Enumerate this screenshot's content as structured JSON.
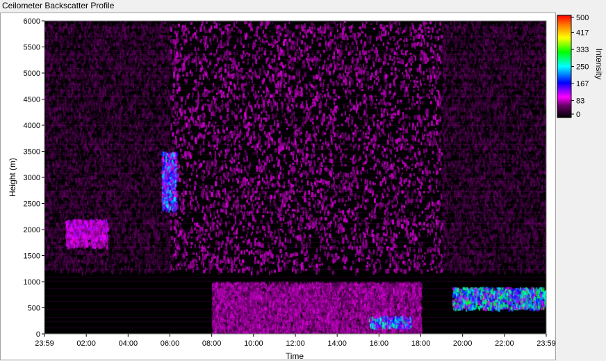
{
  "window": {
    "title": "Ceilometer Backscatter Profile"
  },
  "chart_data": {
    "type": "heatmap",
    "title": "Ceilometer Backscatter Profile",
    "xlabel": "Time",
    "ylabel": "Height (m)",
    "x_ticks": [
      "23:59",
      "02:00",
      "04:00",
      "06:00",
      "08:00",
      "10:00",
      "12:00",
      "14:00",
      "16:00",
      "18:00",
      "20:00",
      "22:00",
      "23:59"
    ],
    "x_range_hours": [
      0,
      24
    ],
    "y_ticks": [
      0,
      500,
      1000,
      1500,
      2000,
      2500,
      3000,
      3500,
      4000,
      4500,
      5000,
      5500,
      6000
    ],
    "ylim": [
      0,
      6000
    ],
    "colorbar": {
      "label": "Intensity",
      "range": [
        0,
        500
      ],
      "ticks": [
        0,
        83,
        167,
        250,
        333,
        417,
        500
      ],
      "tick_labels": [
        "0",
        "83",
        "167",
        "250",
        "333",
        "417",
        "500"
      ],
      "colors": [
        "#000000",
        "#ff00ff",
        "#0000ff",
        "#00ffff",
        "#00ff00",
        "#ffff00",
        "#ff8000",
        "#ff0000"
      ]
    },
    "features": [
      {
        "name": "background noise above 1200 m (night)",
        "time_start_h": 0,
        "time_end_h": 6,
        "height_min": 1200,
        "height_max": 6000,
        "intensity": 25
      },
      {
        "name": "background noise above 1200 m (day)",
        "time_start_h": 6,
        "time_end_h": 19,
        "height_min": 1200,
        "height_max": 6000,
        "intensity": 55
      },
      {
        "name": "background noise above 1200 m (evening)",
        "time_start_h": 19,
        "time_end_h": 24,
        "height_min": 1200,
        "height_max": 6000,
        "intensity": 25
      },
      {
        "name": "boundary layer",
        "time_start_h": 8,
        "time_end_h": 18,
        "height_min": 0,
        "height_max": 1000,
        "intensity": 60
      },
      {
        "name": "early cloud layer",
        "time_start_h": 1.0,
        "time_end_h": 3.0,
        "height_min": 1700,
        "height_max": 2200,
        "intensity": 90
      },
      {
        "name": "cloud near 06:00",
        "time_start_h": 5.6,
        "time_end_h": 6.3,
        "height_min": 2400,
        "height_max": 3500,
        "intensity": 170
      },
      {
        "name": "surface clouds 15:30-17:30",
        "time_start_h": 15.5,
        "time_end_h": 17.5,
        "height_min": 150,
        "height_max": 350,
        "intensity": 200
      },
      {
        "name": "evening low clouds",
        "time_start_h": 19.5,
        "time_end_h": 24,
        "height_min": 500,
        "height_max": 900,
        "intensity": 220
      }
    ]
  }
}
